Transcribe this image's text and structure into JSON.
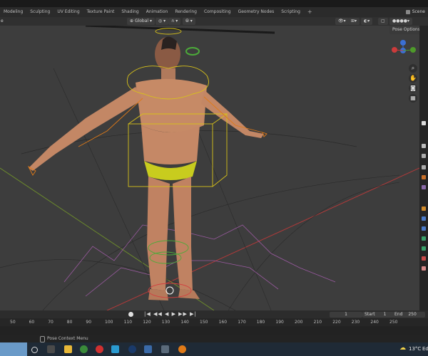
{
  "workspace_tabs": [
    "Modeling",
    "Sculpting",
    "UV Editing",
    "Texture Paint",
    "Shading",
    "Animation",
    "Rendering",
    "Compositing",
    "Geometry Nodes",
    "Scripting",
    "+"
  ],
  "scene_label": "Scene",
  "header": {
    "left_partial": "e",
    "orientation": "Global",
    "pose_options": "Pose Options"
  },
  "timeline": {
    "current_frame": "1",
    "start_label": "Start",
    "start_value": "1",
    "end_label": "End",
    "end_value": "250",
    "frame_ticks": [
      "50",
      "60",
      "70",
      "80",
      "90",
      "100",
      "110",
      "120",
      "130",
      "140",
      "150",
      "160",
      "170",
      "180",
      "190",
      "200",
      "210",
      "220",
      "230",
      "240",
      "250"
    ]
  },
  "status_bar": {
    "context_menu": "Pose Context Menu"
  },
  "taskbar": {
    "weather": "13°C",
    "weather_suffix": "Ed"
  },
  "colors": {
    "viewport_bg": "#3d3d3d",
    "armature_yellow": "#d8c21a",
    "armature_orange": "#e07a18",
    "grid_red": "#b03a3a",
    "grid_green": "#6d8c2c",
    "skin": "#c68a66"
  }
}
